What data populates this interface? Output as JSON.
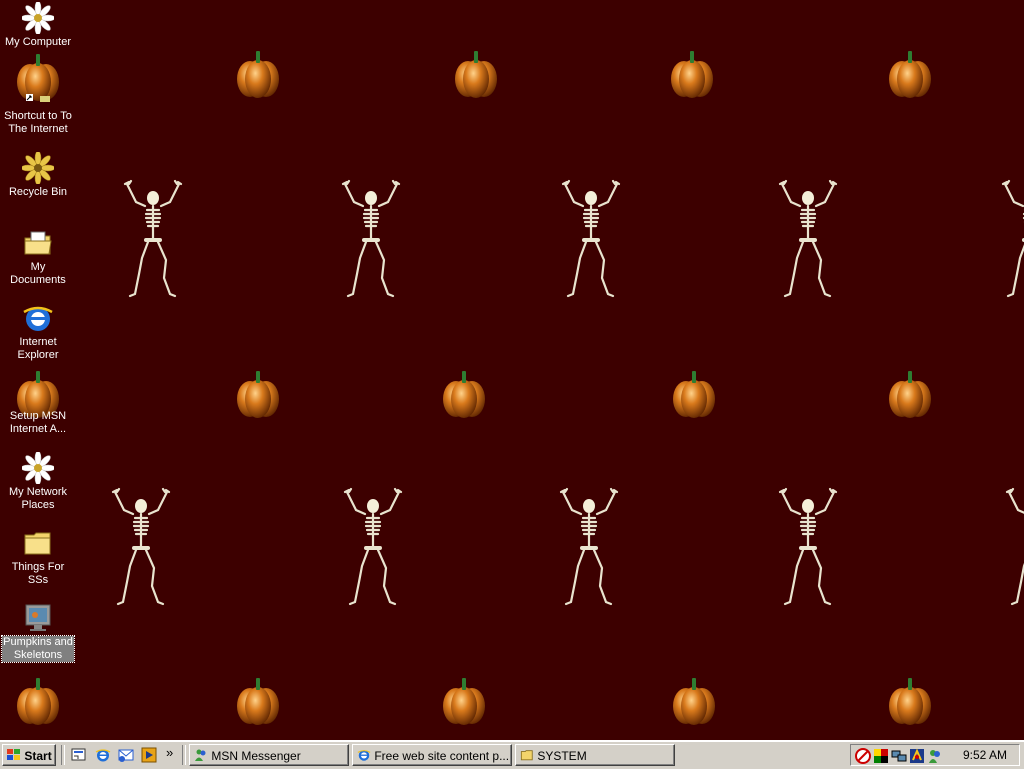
{
  "desktop": {
    "background_color": "#3d0000",
    "icons": [
      {
        "label": "My Computer",
        "icon": "flower-computer-icon"
      },
      {
        "label": "Shortcut to To The Internet",
        "icon": "pumpkin-shortcut-icon"
      },
      {
        "label": "Recycle Bin",
        "icon": "flower-recycle-bin-icon"
      },
      {
        "label": "My Documents",
        "icon": "folder-documents-icon"
      },
      {
        "label": "Internet Explorer",
        "icon": "ie-icon"
      },
      {
        "label": "Setup MSN Internet A...",
        "icon": "pumpkin-setup-icon"
      },
      {
        "label": "My Network Places",
        "icon": "flower-network-icon"
      },
      {
        "label": "Things For SSs",
        "icon": "folder-icon"
      },
      {
        "label": "Pumpkins and Skeletons",
        "icon": "display-icon",
        "selected": true
      }
    ]
  },
  "taskbar": {
    "start_label": "Start",
    "quick_launch": [
      "show-desktop-icon",
      "ie-icon",
      "outlook-icon",
      "media-player-icon"
    ],
    "overflow_label": "»",
    "tasks": [
      {
        "label": "MSN Messenger",
        "icon": "msn-icon"
      },
      {
        "label": "Free web site content p...",
        "icon": "ie-icon"
      },
      {
        "label": "SYSTEM",
        "icon": "folder-icon"
      }
    ],
    "tray_icons": [
      "antivirus-icon",
      "colors-icon",
      "network-icon",
      "security-icon",
      "messenger-icon"
    ],
    "clock": "9:52 AM"
  }
}
